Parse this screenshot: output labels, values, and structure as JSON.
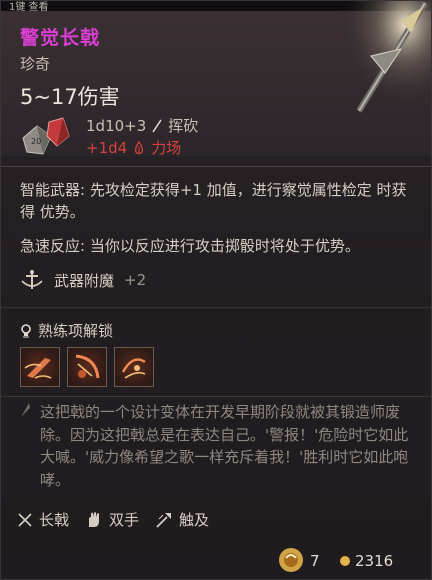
{
  "top_hint": "1键 查看",
  "item": {
    "name": "警觉长戟",
    "rarity": "珍奇",
    "damage": "5~17伤害",
    "damage_formula": "1d10+3",
    "damage_type": "挥砍",
    "extra_damage": "+1d4",
    "extra_damage_type": "力场"
  },
  "abilities": [
    {
      "text": "智能武器: 先攻检定获得+1 加值，进行察觉属性检定 时获得 优势。"
    },
    {
      "text": "急速反应: 当你以反应进行攻击掷骰时将处于优势。"
    }
  ],
  "enchantment": {
    "label": "武器附魔",
    "value": "+2"
  },
  "proficiency": {
    "label": "熟练项解锁",
    "actions": [
      "action-1",
      "action-2",
      "action-3"
    ]
  },
  "flavor_text": "这把戟的一个设计变体在开发早期阶段就被其锻造师废除。因为这把戟总是在表达自己。'警报！'危险时它如此大喊。'威力像希望之歌一样充斥着我！'胜利时它如此咆哮。",
  "properties": [
    {
      "label": "长戟",
      "icon": "halberd-icon"
    },
    {
      "label": "双手",
      "icon": "two-handed-icon"
    },
    {
      "label": "触及",
      "icon": "reach-icon"
    }
  ],
  "footer": {
    "weight": "7",
    "value": "2316"
  },
  "colors": {
    "name": "#d93fd1",
    "extra_damage": "#d7433c",
    "gold": "#e2b24a"
  }
}
